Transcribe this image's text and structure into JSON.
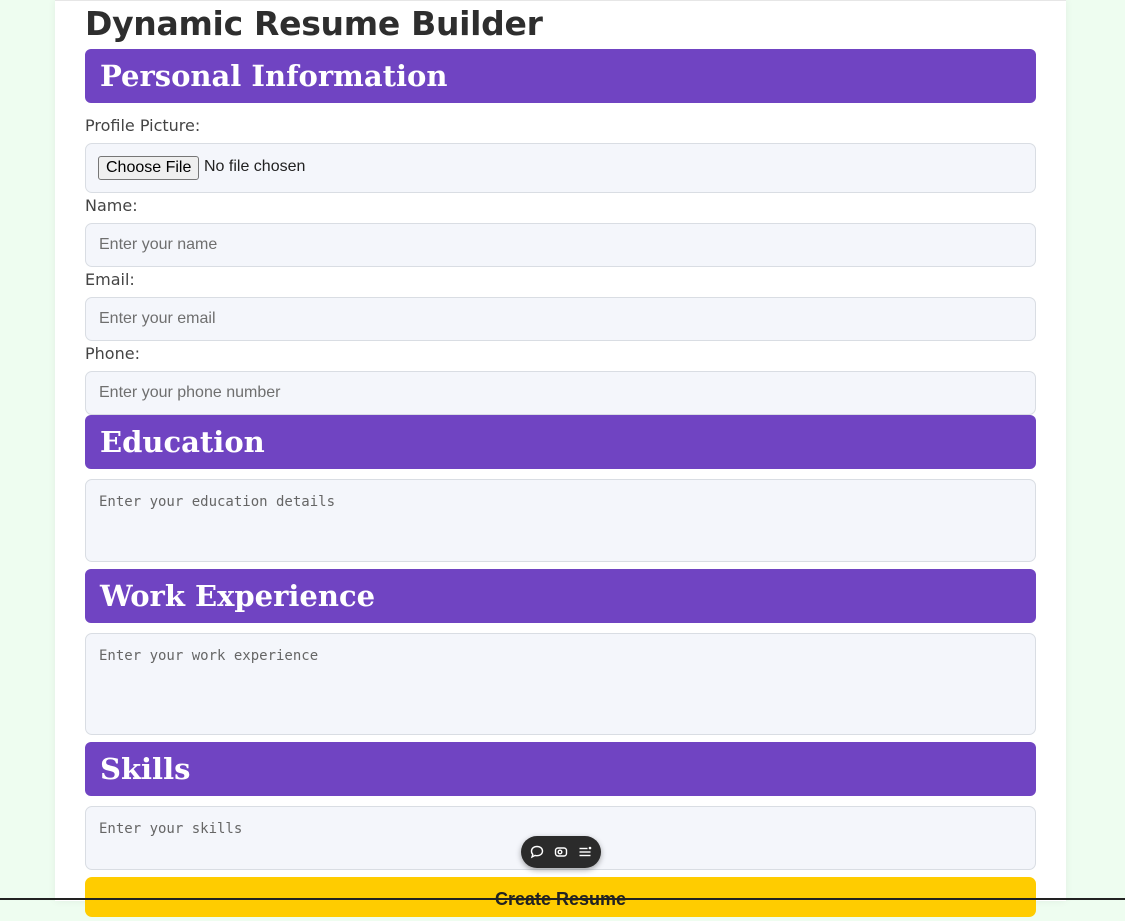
{
  "page_title": "Dynamic Resume Builder",
  "sections": {
    "personal": {
      "heading": "Personal Information",
      "profile_label": "Profile Picture:",
      "file_button": "Choose File",
      "file_status": "No file chosen",
      "name_label": "Name:",
      "name_placeholder": "Enter your name",
      "email_label": "Email:",
      "email_placeholder": "Enter your email",
      "phone_label": "Phone:",
      "phone_placeholder": "Enter your phone number"
    },
    "education": {
      "heading": "Education",
      "placeholder": "Enter your education details"
    },
    "work": {
      "heading": "Work Experience",
      "placeholder": "Enter your work experience"
    },
    "skills": {
      "heading": "Skills",
      "placeholder": "Enter your skills"
    }
  },
  "submit_label": "Create Resume",
  "floating_toolbar": {
    "icons": [
      "chat-bubble-icon",
      "screenshot-icon",
      "menu-list-icon"
    ]
  },
  "colors": {
    "page_background": "#eefdf0",
    "section_header": "#7044c2",
    "submit_button": "#ffcc00",
    "field_background": "#f4f6fb"
  }
}
